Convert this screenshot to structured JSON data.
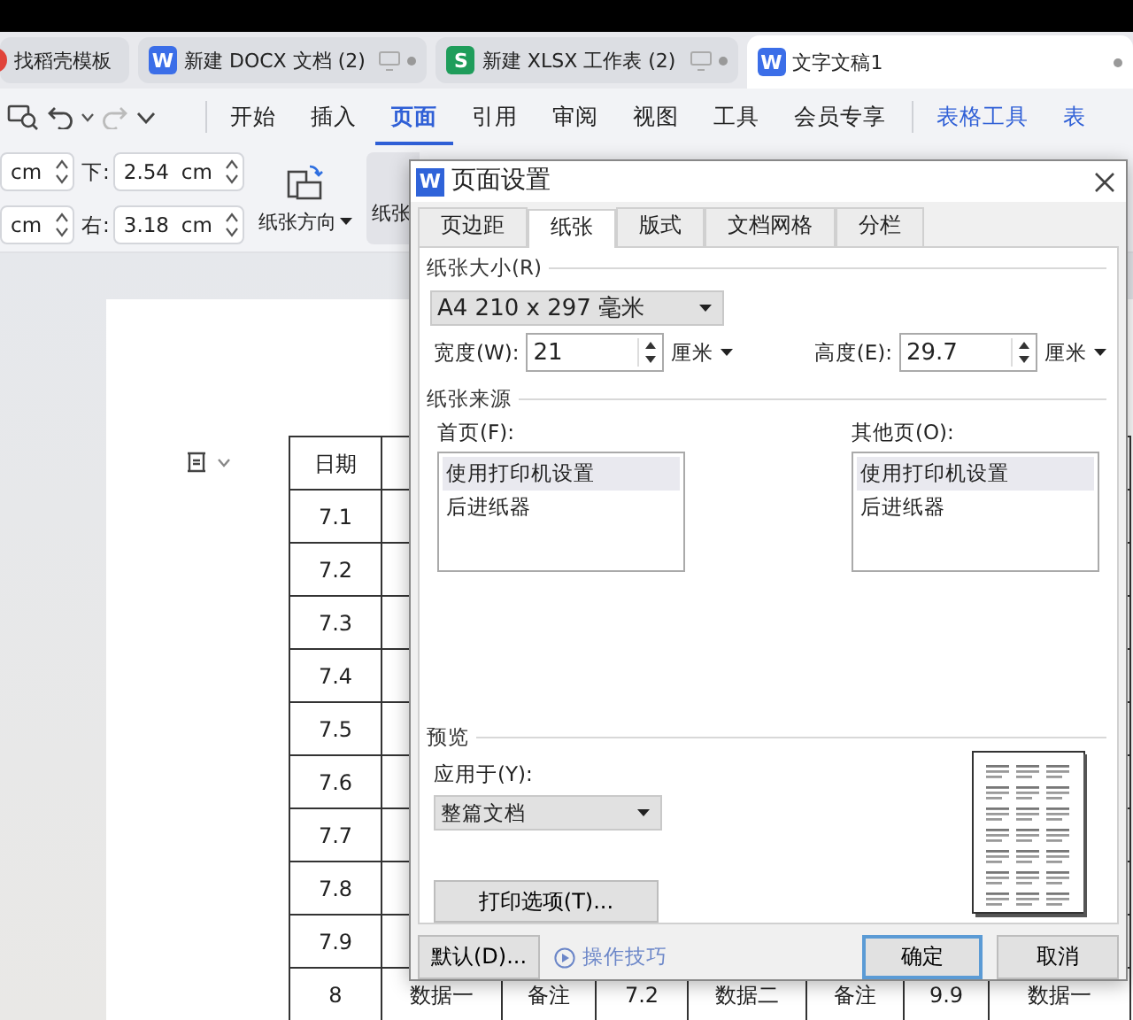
{
  "tabs": [
    {
      "label": "找稻壳模板",
      "color": "#e0433a",
      "selected": false
    },
    {
      "label": "新建 DOCX 文档 (2)",
      "icon": "W",
      "color": "#3b6ee8",
      "selected": false
    },
    {
      "label": "新建 XLSX 工作表 (2)",
      "icon": "S",
      "color": "#1f9d5b",
      "selected": false
    },
    {
      "label": "文字文稿1",
      "icon": "W",
      "color": "#3b6ee8",
      "selected": true
    }
  ],
  "menu": [
    {
      "label": "开始",
      "kind": "normal",
      "selected": false
    },
    {
      "label": "插入",
      "kind": "normal",
      "selected": false
    },
    {
      "label": "页面",
      "kind": "normal",
      "selected": true
    },
    {
      "label": "引用",
      "kind": "normal",
      "selected": false
    },
    {
      "label": "审阅",
      "kind": "normal",
      "selected": false
    },
    {
      "label": "视图",
      "kind": "normal",
      "selected": false
    },
    {
      "label": "工具",
      "kind": "normal",
      "selected": false
    },
    {
      "label": "会员专享",
      "kind": "normal",
      "selected": false
    },
    {
      "label": "表格工具",
      "kind": "context",
      "selected": false
    },
    {
      "label": "表",
      "kind": "context",
      "selected": false
    }
  ],
  "toolbar": {
    "spinners": [
      {
        "unit": "cm"
      },
      {
        "label": "下:",
        "value": "2.54",
        "unit": "cm"
      },
      {
        "unit": "cm"
      },
      {
        "label": "右:",
        "value": "3.18",
        "unit": "cm"
      }
    ],
    "orientation_button": "纸张方向",
    "size_button": "纸张"
  },
  "table": {
    "columns": [
      "日期"
    ],
    "rows": [
      [
        "7.1"
      ],
      [
        "7.2"
      ],
      [
        "7.3"
      ],
      [
        "7.4"
      ],
      [
        "7.5"
      ],
      [
        "7.6"
      ],
      [
        "7.7"
      ],
      [
        "7.8"
      ],
      [
        "7.9"
      ],
      [
        "8",
        "数据一",
        "备注",
        "7.2",
        "数据二",
        "备注",
        "9.9",
        "数据一"
      ]
    ]
  },
  "dialog": {
    "icon": "W",
    "title": "页面设置",
    "tabs": [
      {
        "label": "页边距",
        "selected": false
      },
      {
        "label": "纸张",
        "selected": true
      },
      {
        "label": "版式",
        "selected": false
      },
      {
        "label": "文档网格",
        "selected": false
      },
      {
        "label": "分栏",
        "selected": false
      }
    ],
    "paper_size": {
      "heading": "纸张大小(R)",
      "value": "A4 210 x 297 毫米"
    },
    "width": {
      "label": "宽度(W):",
      "value": "21",
      "unit": "厘米"
    },
    "height": {
      "label": "高度(E):",
      "value": "29.7",
      "unit": "厘米"
    },
    "paper_source": {
      "heading": "纸张来源",
      "lists": [
        {
          "label": "首页(F):",
          "items": [
            {
              "label": "使用打印机设置",
              "selected": true
            },
            {
              "label": "后进纸器",
              "selected": false
            }
          ]
        },
        {
          "label": "其他页(O):",
          "items": [
            {
              "label": "使用打印机设置",
              "selected": true
            },
            {
              "label": "后进纸器",
              "selected": false
            }
          ]
        }
      ]
    },
    "preview": {
      "heading": "预览",
      "apply_label": "应用于(Y):",
      "apply_value": "整篇文档",
      "print_options": "打印选项(T)..."
    },
    "footer": {
      "default_button": "默认(D)...",
      "tips_link": "操作技巧",
      "ok_button": "确定",
      "cancel_button": "取消"
    }
  }
}
